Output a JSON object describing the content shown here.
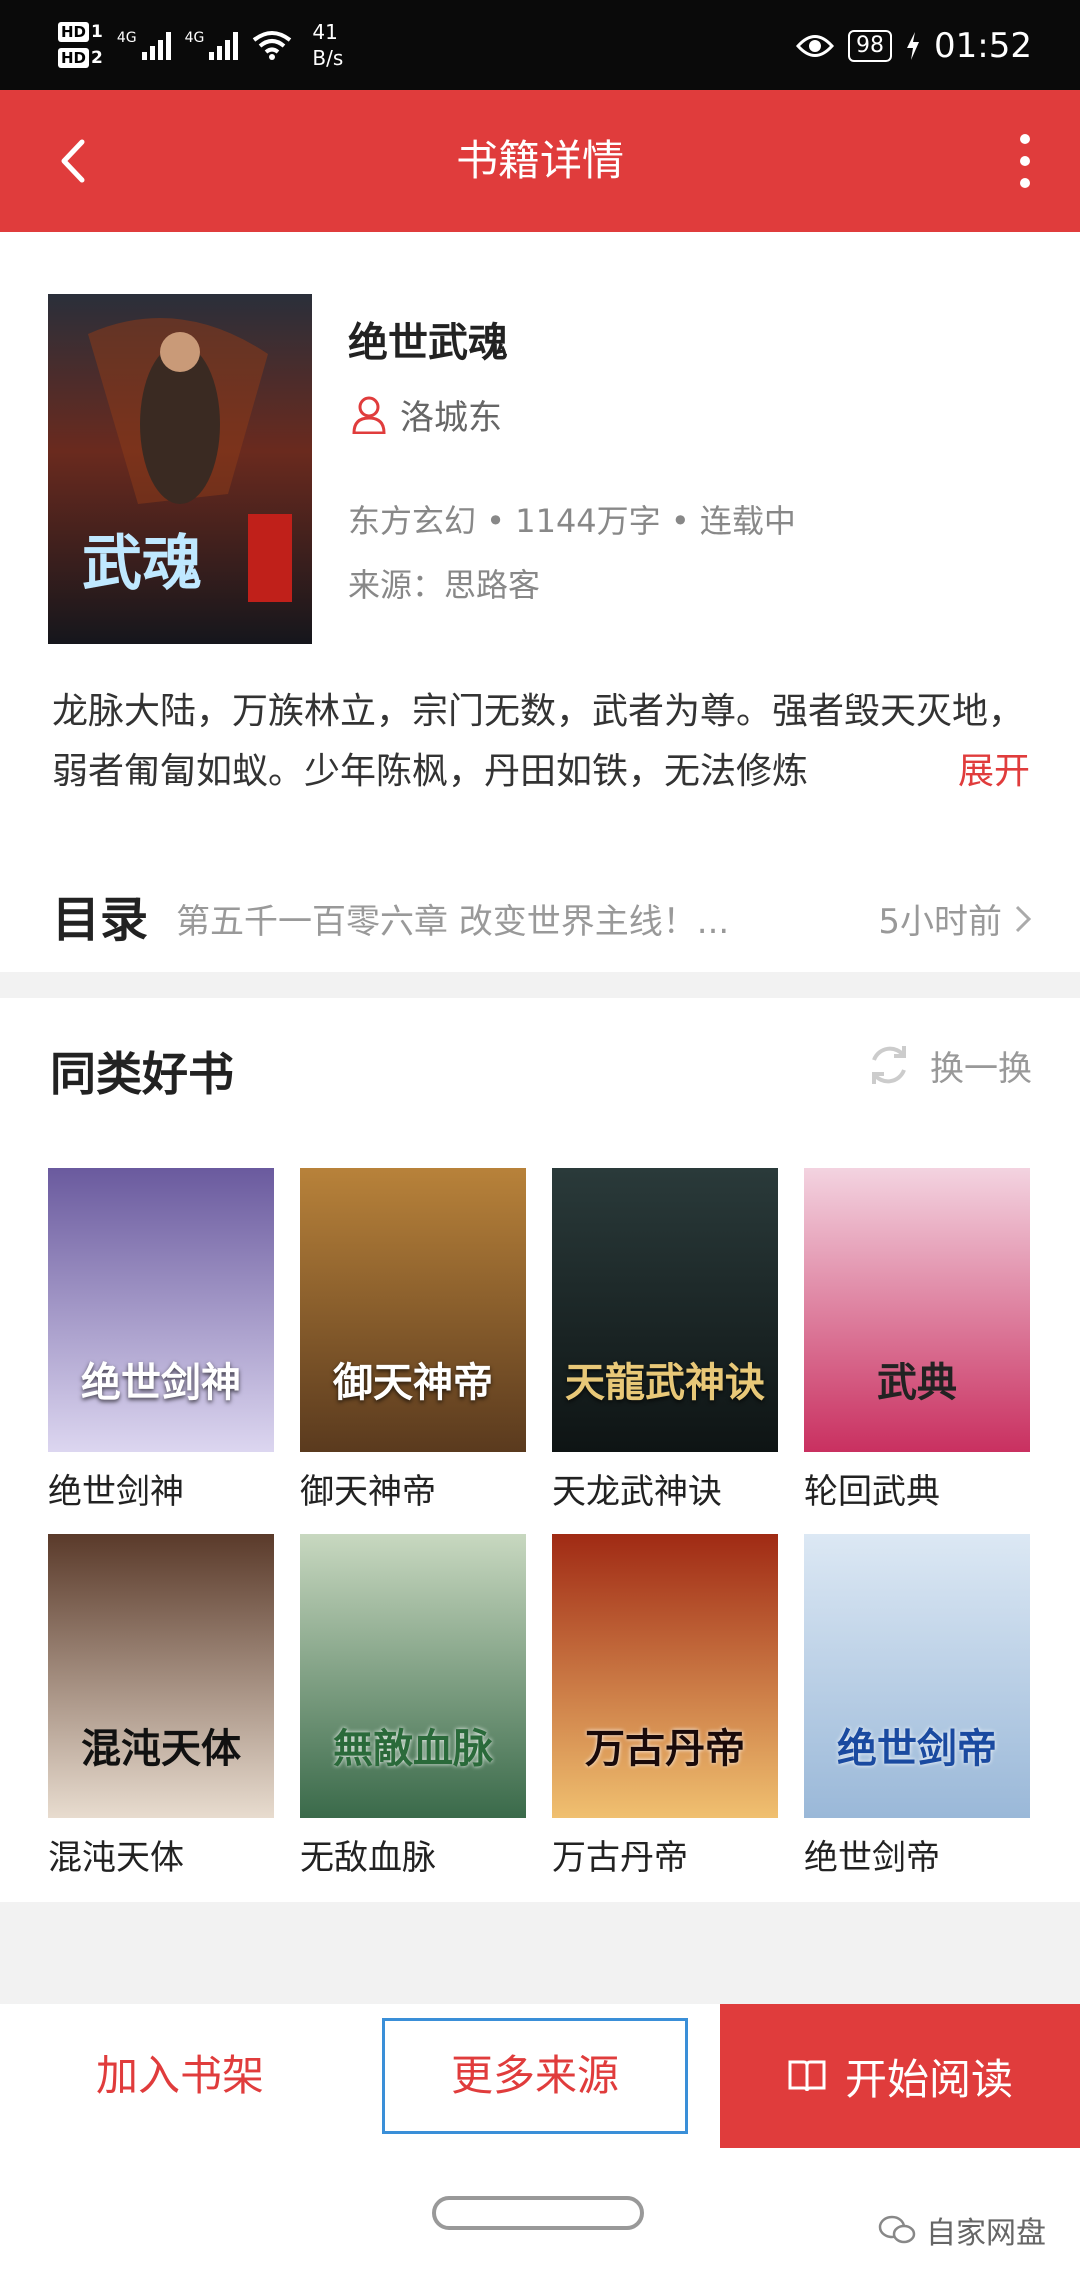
{
  "status_bar": {
    "hd1": "HD",
    "hd1_sub": "1",
    "hd2": "HD",
    "hd2_sub": "2",
    "sig1_label": "4G",
    "sig2_label": "4G",
    "net_speed_value": "41",
    "net_speed_unit": "B/s",
    "battery": "98",
    "time": "01:52"
  },
  "app_bar": {
    "title": "书籍详情"
  },
  "book": {
    "title": "绝世武魂",
    "author": "洛城东",
    "meta": "东方玄幻 • 1144万字 • 连载中",
    "source": "来源：思路客",
    "description": "龙脉大陆，万族林立，宗门无数，武者为尊。强者毁天灭地，弱者匍匐如蚁。少年陈枫，丹田如铁，无法修炼",
    "expand_label": "展开",
    "cover_title": "武魂"
  },
  "toc": {
    "label": "目录",
    "latest_chapter": "第五千一百零六章 改变世界主线！...",
    "updated": "5小时前"
  },
  "similar": {
    "title": "同类好书",
    "refresh_label": "换一换",
    "books": [
      {
        "name": "绝世剑神",
        "cover_text": "绝世剑神",
        "color_top": "#6a5a9e",
        "color_bottom": "#dcd6f0"
      },
      {
        "name": "御天神帝",
        "cover_text": "御天神帝",
        "color_top": "#b8823a",
        "color_bottom": "#5a3a1e"
      },
      {
        "name": "天龙武神诀",
        "cover_text": "天龍武神诀",
        "color_top": "#2a3a3a",
        "color_bottom": "#0e1414"
      },
      {
        "name": "轮回武典",
        "cover_text": "武典",
        "color_top": "#f3d3e0",
        "color_bottom": "#c93060"
      },
      {
        "name": "混沌天体",
        "cover_text": "混沌天体",
        "color_top": "#5a3a2a",
        "color_bottom": "#e8dccf"
      },
      {
        "name": "无敌血脉",
        "cover_text": "無敵血脉",
        "color_top": "#c8d8c0",
        "color_bottom": "#3a6a4a"
      },
      {
        "name": "万古丹帝",
        "cover_text": "万古丹帝",
        "color_top": "#a02a14",
        "color_bottom": "#f0c070"
      },
      {
        "name": "绝世剑帝",
        "cover_text": "绝世剑帝",
        "color_top": "#dce8f4",
        "color_bottom": "#9ab8d8"
      }
    ]
  },
  "actions": {
    "add_shelf": "加入书架",
    "more_sources": "更多来源",
    "start_reading": "开始阅读"
  },
  "watermark": "自家网盘",
  "colors": {
    "accent": "#e03c3c",
    "focus_border": "#3a8fd8"
  }
}
